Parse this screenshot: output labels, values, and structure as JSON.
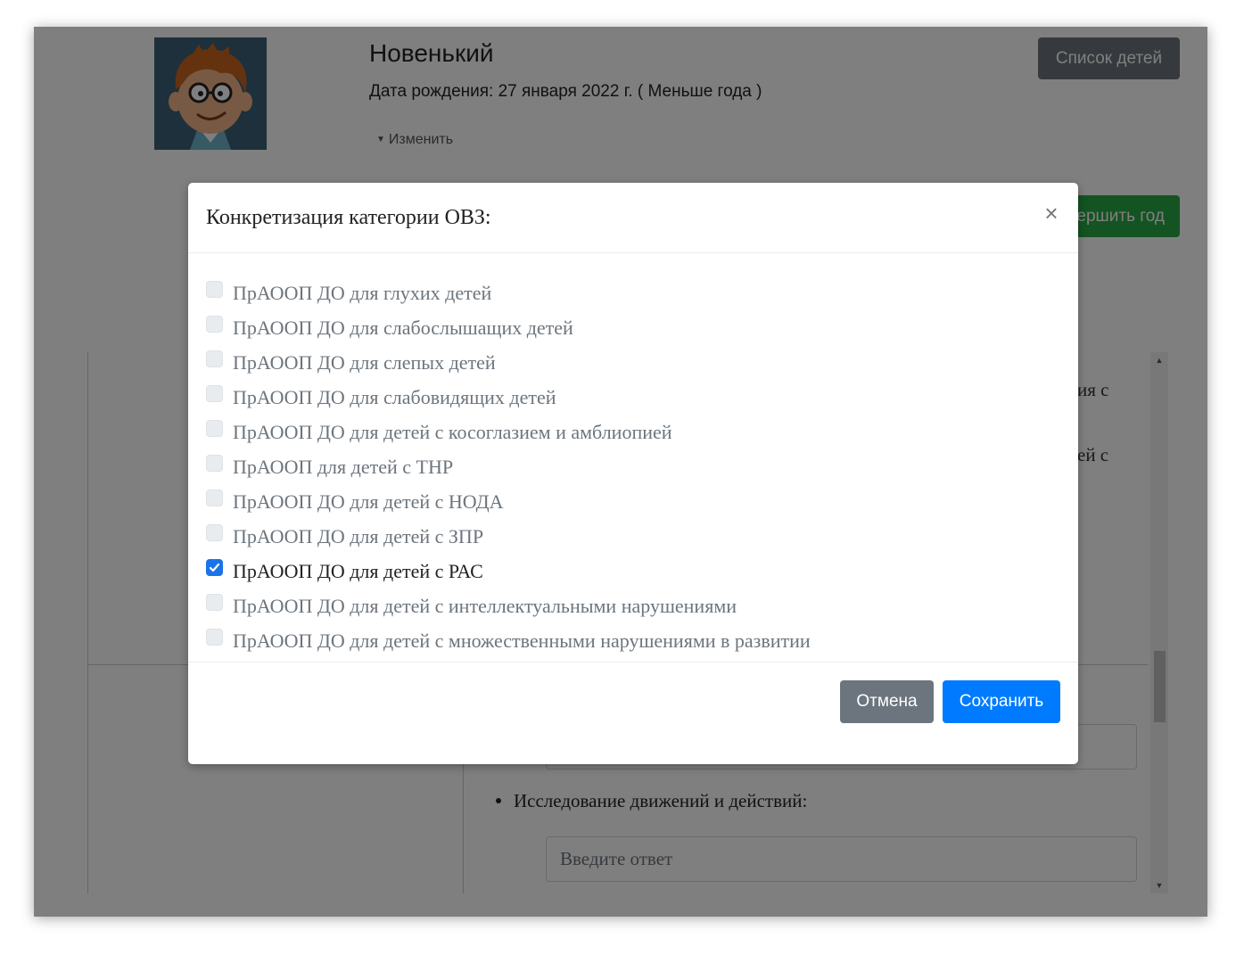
{
  "child": {
    "name": "Новенький",
    "birth_date": "Дата рождения: 27 января 2022 г. ( Меньше года )",
    "edit_toggle": "Изменить"
  },
  "header_buttons": {
    "children_list": "Список детей",
    "finish_year": "ершить год"
  },
  "background": {
    "fragment_1": "ия с",
    "fragment_2": "ей с",
    "bullet_item": "Исследование движений и действий:",
    "answer_placeholder": "Введите ответ"
  },
  "modal": {
    "title": "Конкретизация категории ОВЗ:",
    "close_symbol": "×",
    "options": [
      {
        "label": "ПрАООП ДО для глухих детей",
        "checked": false
      },
      {
        "label": "ПрАООП ДО для слабослышащих детей",
        "checked": false
      },
      {
        "label": "ПрАООП ДО для слепых детей",
        "checked": false
      },
      {
        "label": "ПрАООП ДО для слабовидящих детей",
        "checked": false
      },
      {
        "label": "ПрАООП ДО для детей с косоглазием и амблиопией",
        "checked": false
      },
      {
        "label": "ПрАООП для детей с ТНР",
        "checked": false
      },
      {
        "label": "ПрАООП ДО для детей с НОДА",
        "checked": false
      },
      {
        "label": "ПрАООП ДО для детей с ЗПР",
        "checked": false
      },
      {
        "label": "ПрАООП ДО для детей с РАС",
        "checked": true
      },
      {
        "label": "ПрАООП ДО для детей с интеллектуальными нарушениями",
        "checked": false
      },
      {
        "label": "ПрАООП ДО для детей с множественными нарушениями в развитии",
        "checked": false
      }
    ],
    "cancel_label": "Отмена",
    "save_label": "Сохранить"
  },
  "colors": {
    "primary": "#007bff",
    "secondary": "#6c757d",
    "success": "#28a745",
    "checkbox_checked": "#1a73e8"
  },
  "icons": {
    "avatar": "cartoon-boy-avatar",
    "caret": "caret-down-icon",
    "close": "close-icon",
    "check": "checkmark-icon"
  }
}
